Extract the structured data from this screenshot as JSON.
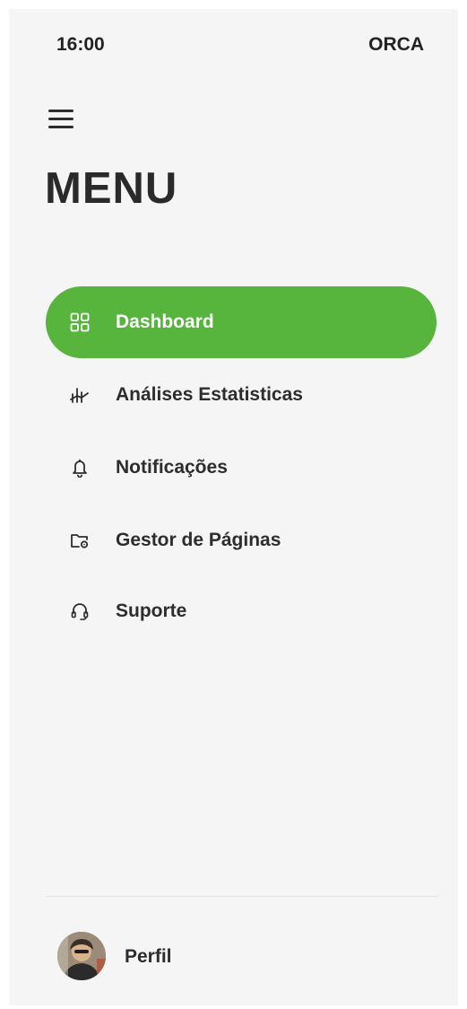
{
  "status_bar": {
    "time": "16:00",
    "carrier": "ORCA"
  },
  "header": {
    "title": "MENU"
  },
  "nav": {
    "items": [
      {
        "label": "Dashboard",
        "icon": "grid-icon",
        "active": true
      },
      {
        "label": "Análises Estatisticas",
        "icon": "chart-icon",
        "active": false
      },
      {
        "label": "Notificações",
        "icon": "bell-icon",
        "active": false
      },
      {
        "label": "Gestor de Páginas",
        "icon": "folder-settings-icon",
        "active": false
      },
      {
        "label": "Suporte",
        "icon": "headset-icon",
        "active": false
      }
    ]
  },
  "profile": {
    "label": "Perfil"
  },
  "colors": {
    "accent": "#57b53d",
    "background": "#f5f5f5",
    "text": "#2d2d2d"
  }
}
